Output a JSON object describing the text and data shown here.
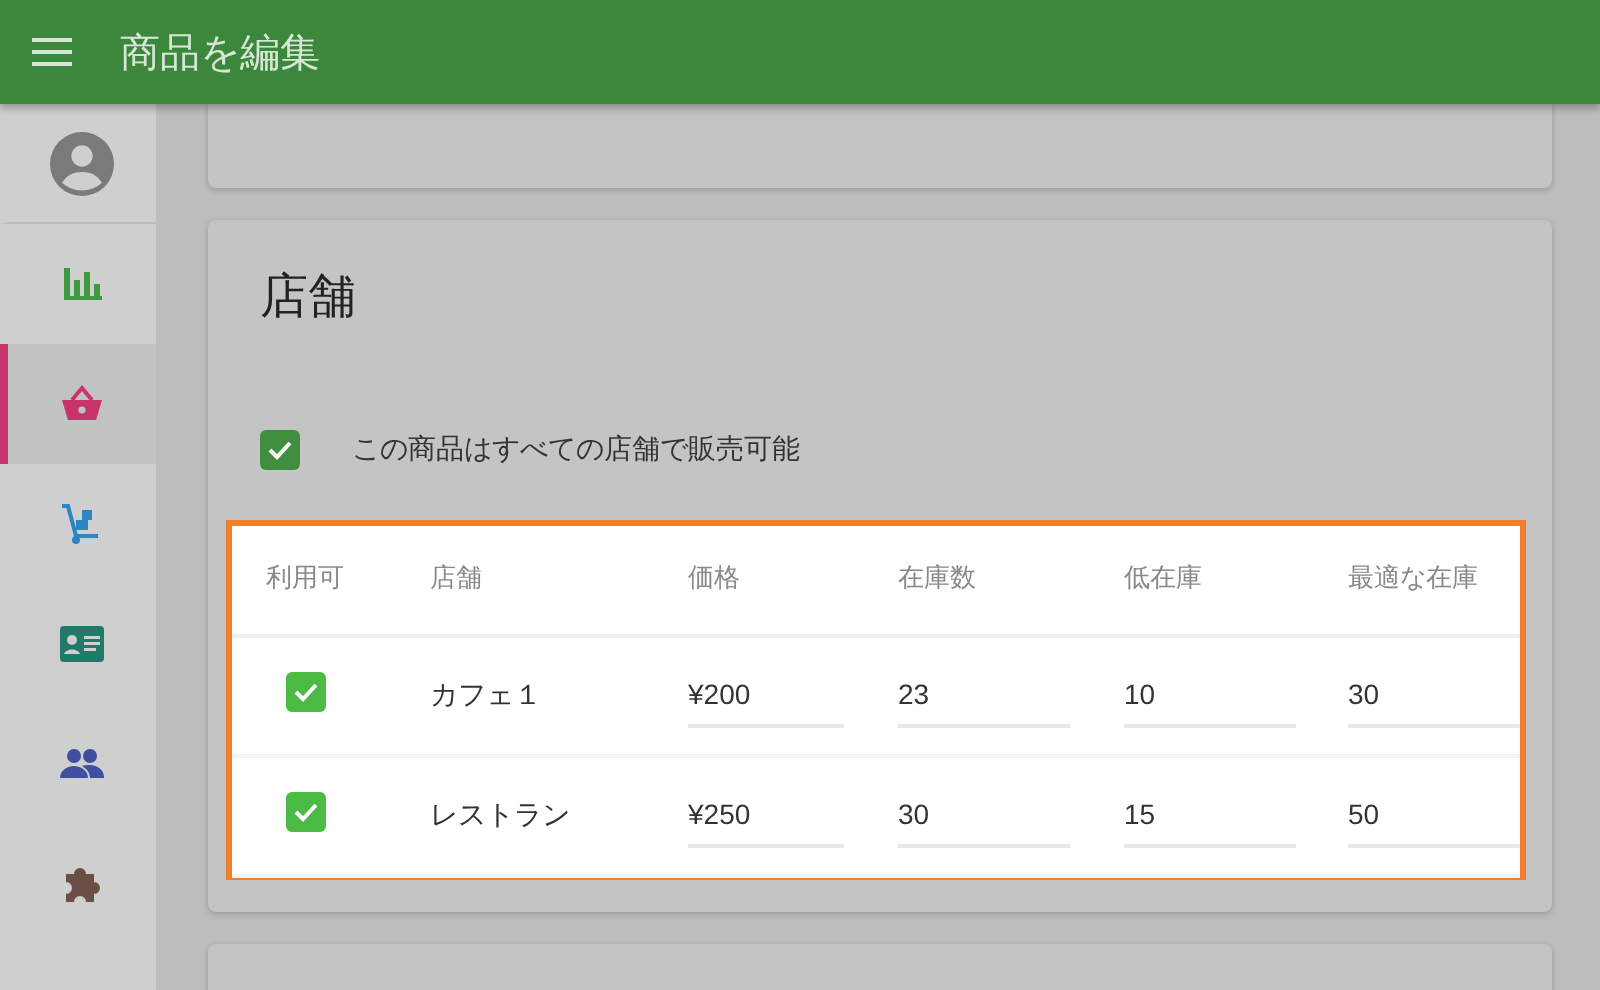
{
  "header": {
    "title": "商品を編集"
  },
  "sidebar": {
    "items": [
      {
        "kind": "avatar",
        "selected": false,
        "color": "#7a7a7a"
      },
      {
        "kind": "chart",
        "selected": false,
        "color": "#3f9a3f"
      },
      {
        "kind": "basket",
        "selected": true,
        "color": "#c8336b"
      },
      {
        "kind": "cart",
        "selected": false,
        "color": "#2b87c4"
      },
      {
        "kind": "card",
        "selected": false,
        "color": "#1f7a6a"
      },
      {
        "kind": "people",
        "selected": false,
        "color": "#3f4fa0"
      },
      {
        "kind": "puzzle",
        "selected": false,
        "color": "#6b4f45"
      }
    ]
  },
  "stores": {
    "title": "店舗",
    "all_stores": {
      "label": "この商品はすべての店舗で販売可能",
      "checked": true
    },
    "columns": [
      "利用可",
      "店舗",
      "価格",
      "在庫数",
      "低在庫",
      "最適な在庫"
    ],
    "rows": [
      {
        "available": true,
        "store": "カフェ１",
        "price": "¥200",
        "stock": "23",
        "low_stock": "10",
        "optimal_stock": "30"
      },
      {
        "available": true,
        "store": "レストラン",
        "price": "¥250",
        "stock": "30",
        "low_stock": "15",
        "optimal_stock": "50"
      }
    ]
  }
}
